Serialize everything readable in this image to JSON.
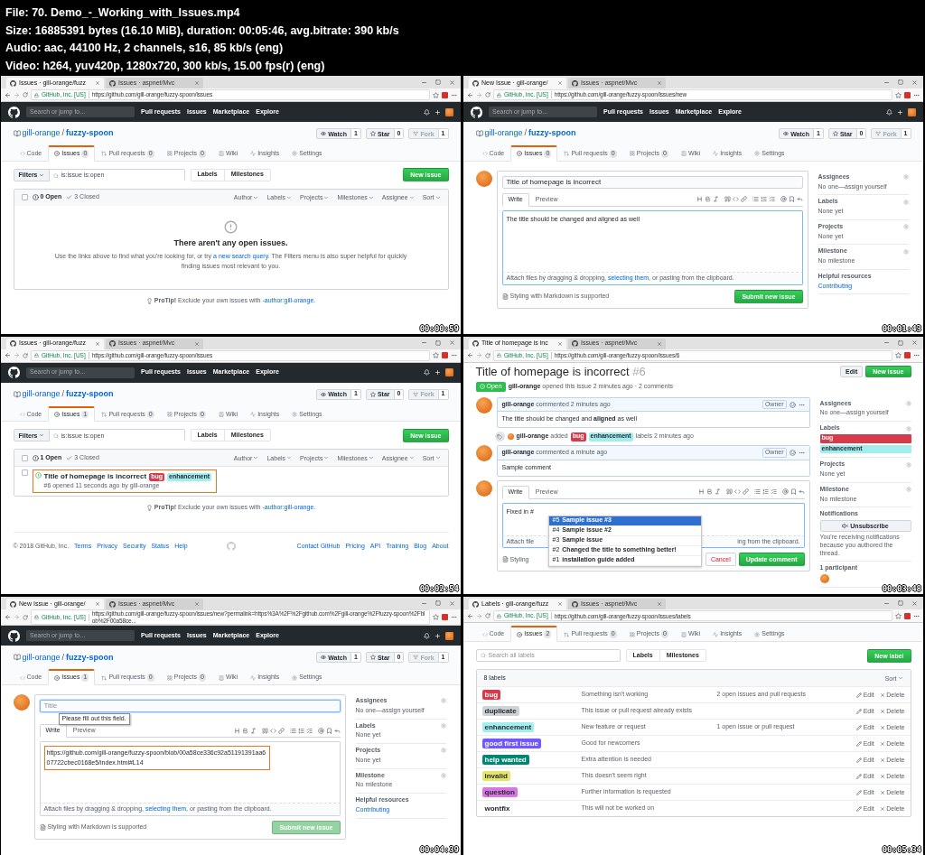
{
  "file_info": [
    "File: 70. Demo_-_Working_with_Issues.mp4",
    "Size: 16885391 bytes (16.10 MiB), duration: 00:05:46, avg.bitrate: 390 kb/s",
    "Audio: aac, 44100 Hz, 2 channels, s16, 85 kb/s (eng)",
    "Video: h264, yuv420p, 1280x720, 300 kb/s, 15.00 fps(r) (eng)"
  ],
  "frames": [
    {
      "timestamp": "00:00:59",
      "browser": {
        "tabs": [
          {
            "title": "Issues · gill-orange/fuzz",
            "selected": true
          },
          {
            "title": "Issues · aspnet/Mvc",
            "selected": false
          }
        ],
        "site": "GitHub, Inc. [US]",
        "url": "https://github.com/gill-orange/fuzzy-spoon/issues"
      },
      "header": {
        "search": {
          "placeholder": "Search or jump to..."
        },
        "links": [
          "Pull requests",
          "Issues",
          "Marketplace",
          "Explore"
        ]
      },
      "repo": {
        "owner": "gill-orange",
        "separator": "/",
        "name": "fuzzy-spoon",
        "actions": [
          {
            "label": "Watch",
            "count": "1",
            "disabled": false
          },
          {
            "label": "Star",
            "count": "0",
            "disabled": false
          },
          {
            "label": "Fork",
            "count": "1",
            "disabled": true
          }
        ],
        "tabs": [
          {
            "label": "Code",
            "selected": false
          },
          {
            "label": "Issues",
            "count": "0",
            "selected": true
          },
          {
            "label": "Pull requests",
            "count": "0",
            "selected": false
          },
          {
            "label": "Projects",
            "count": "0",
            "selected": false
          },
          {
            "label": "Wiki",
            "selected": false
          },
          {
            "label": "Insights",
            "selected": false
          },
          {
            "label": "Settings",
            "selected": false
          }
        ]
      },
      "content": {
        "kind": "issues",
        "filters_button": "Filters",
        "search": {
          "value": "is:issue is:open"
        },
        "nav": [
          "Labels",
          "Milestones"
        ],
        "new_button": "New issue",
        "select_all_checked": false,
        "open_count": "0 Open",
        "closed_count": "3 Closed",
        "sorters": [
          "Author",
          "Labels",
          "Projects",
          "Milestones",
          "Assignee",
          "Sort"
        ],
        "blankslate": {
          "title": "There aren't any open issues.",
          "text_before": "Use the links above to find what you're looking for, or try",
          "link": "a new search query",
          "text_after": ". The Filters menu is also super helpful for quickly finding issues most relevant to you."
        },
        "protip": {
          "label": "ProTip!",
          "text": "Exclude your own issues with",
          "link": "-author:gill-orange."
        }
      }
    },
    {
      "timestamp": "00:01:43",
      "browser": {
        "tabs": [
          {
            "title": "New Issue · gill-orange/",
            "selected": true
          },
          {
            "title": "Issues · aspnet/Mvc",
            "selected": false
          }
        ],
        "site": "GitHub, Inc. [US]",
        "url": "https://github.com/gill-orange/fuzzy-spoon/issues/new"
      },
      "header": {
        "search": {
          "placeholder": "Search or jump to..."
        },
        "links": [
          "Pull requests",
          "Issues",
          "Marketplace",
          "Explore"
        ]
      },
      "repo": {
        "owner": "gill-orange",
        "separator": "/",
        "name": "fuzzy-spoon",
        "actions": [
          {
            "label": "Watch",
            "count": "1",
            "disabled": false
          },
          {
            "label": "Star",
            "count": "0",
            "disabled": false
          },
          {
            "label": "Fork",
            "count": "1",
            "disabled": true
          }
        ],
        "tabs": [
          {
            "label": "Code",
            "selected": false
          },
          {
            "label": "Issues",
            "count": "0",
            "selected": true
          },
          {
            "label": "Pull requests",
            "count": "0",
            "selected": false
          },
          {
            "label": "Projects",
            "count": "0",
            "selected": false
          },
          {
            "label": "Wiki",
            "selected": false
          },
          {
            "label": "Insights",
            "selected": false
          },
          {
            "label": "Settings",
            "selected": false
          }
        ]
      },
      "content": {
        "kind": "new_issue",
        "title_field": {
          "value": "Title of homepage is incorrect",
          "focused": false
        },
        "editor_tabs": [
          {
            "label": "Write",
            "selected": true
          },
          {
            "label": "Preview",
            "selected": false
          }
        ],
        "body": {
          "value": "The title should be changed and aligned as well",
          "highlighted": false
        },
        "attach": {
          "before": "Attach files by dragging & dropping,",
          "link": "selecting them",
          "after": ", or pasting from the clipboard."
        },
        "markdown_note": "Styling with Markdown is supported",
        "submit": {
          "label": "Submit new issue",
          "disabled": false
        },
        "sidebar": [
          {
            "title": "Assignees",
            "value": "No one—assign yourself"
          },
          {
            "title": "Labels",
            "value": "None yet"
          },
          {
            "title": "Projects",
            "value": "None yet"
          },
          {
            "title": "Milestone",
            "value": "No milestone"
          },
          {
            "title": "Helpful resources",
            "link": "Contributing"
          }
        ]
      }
    },
    {
      "timestamp": "00:02:54",
      "browser": {
        "tabs": [
          {
            "title": "Issues · gill-orange/fuzz",
            "selected": true
          },
          {
            "title": "Issues · aspnet/Mvc",
            "selected": false
          }
        ],
        "site": "GitHub, Inc. [US]",
        "url": "https://github.com/gill-orange/fuzzy-spoon/issues"
      },
      "header": {
        "search": {
          "placeholder": "Search or jump to..."
        },
        "links": [
          "Pull requests",
          "Issues",
          "Marketplace",
          "Explore"
        ]
      },
      "repo": {
        "owner": "gill-orange",
        "separator": "/",
        "name": "fuzzy-spoon",
        "actions": [
          {
            "label": "Watch",
            "count": "1",
            "disabled": false
          },
          {
            "label": "Star",
            "count": "0",
            "disabled": false
          },
          {
            "label": "Fork",
            "count": "1",
            "disabled": true
          }
        ],
        "tabs": [
          {
            "label": "Code",
            "selected": false
          },
          {
            "label": "Issues",
            "count": "1",
            "selected": true
          },
          {
            "label": "Pull requests",
            "count": "0",
            "selected": false
          },
          {
            "label": "Projects",
            "count": "0",
            "selected": false
          },
          {
            "label": "Wiki",
            "selected": false
          },
          {
            "label": "Insights",
            "selected": false
          },
          {
            "label": "Settings",
            "selected": false
          }
        ]
      },
      "content": {
        "kind": "issues",
        "filters_button": "Filters",
        "search": {
          "value": "is:issue is:open"
        },
        "nav": [
          "Labels",
          "Milestones"
        ],
        "new_button": "New issue",
        "select_all_checked": false,
        "open_count": "1 Open",
        "closed_count": "3 Closed",
        "sorters": [
          "Author",
          "Labels",
          "Projects",
          "Milestones",
          "Assignee",
          "Sort"
        ],
        "rows": [
          {
            "title": "Title of homepage is incorrect",
            "labels": [
              {
                "name": "bug",
                "color": "#d73a4a"
              },
              {
                "name": "enhancement",
                "color": "#a2eeef"
              }
            ],
            "meta": "#6 opened 11 seconds ago by gill-orange",
            "highlighted": true,
            "checked": false
          }
        ],
        "protip": {
          "label": "ProTip!",
          "text": "Exclude your own issues with",
          "link": "-author:gill-orange."
        },
        "footer": {
          "copyright": "© 2018 GitHub, Inc.",
          "left": [
            "Terms",
            "Privacy",
            "Security",
            "Status",
            "Help"
          ],
          "right": [
            "Contact GitHub",
            "Pricing",
            "API",
            "Training",
            "Blog",
            "About"
          ]
        }
      }
    },
    {
      "timestamp": "00:03:48",
      "browser": {
        "tabs": [
          {
            "title": "Title of homepage is inc",
            "selected": true
          },
          {
            "title": "Issues · aspnet/Mvc",
            "selected": false
          }
        ],
        "site": "GitHub, Inc. [US]",
        "url": "https://github.com/gill-orange/fuzzy-spoon/issues/6"
      },
      "content": {
        "kind": "issue",
        "title": "Title of homepage is incorrect",
        "number": "#6",
        "header_buttons": [
          {
            "label": "Edit",
            "primary": false
          },
          {
            "label": "New issue",
            "primary": true
          }
        ],
        "state": "Open",
        "author": "gill-orange",
        "meta": "opened this issue 2 minutes ago · 2 comments",
        "timeline": [
          {
            "kind": "comment",
            "author": "gill-orange",
            "time": "commented 2 minutes ago",
            "badge": "Owner",
            "body": "The title should be changed and **aligned** as well"
          },
          {
            "kind": "labels",
            "author": "gill-orange",
            "action": "added",
            "labels": [
              {
                "name": "bug",
                "color": "#d73a4a"
              },
              {
                "name": "enhancement",
                "color": "#a2eeef"
              }
            ],
            "time": "labels 2 minutes ago"
          },
          {
            "kind": "comment",
            "author": "gill-orange",
            "time": "commented a minute ago",
            "badge": "Owner",
            "body": "Sample comment"
          }
        ],
        "editor": {
          "tabs": [
            {
              "label": "Write",
              "selected": true
            },
            {
              "label": "Preview",
              "selected": false
            }
          ],
          "value": "Fixed in #",
          "suggestions": [
            {
              "number": "#5",
              "title": "Sample issue #3",
              "selected": true
            },
            {
              "number": "#4",
              "title": "Sample issue #2",
              "selected": false
            },
            {
              "number": "#3",
              "title": "Sample issue",
              "selected": false
            },
            {
              "number": "#2",
              "title": "Changed the title to something better!",
              "selected": false
            },
            {
              "number": "#1",
              "title": "installation guide added",
              "selected": false
            }
          ],
          "attach_left": "Attach file",
          "attach_right": "ing from the clipboard.",
          "markdown_note": "Styling",
          "cancel": "Cancel",
          "submit": "Update comment"
        },
        "sidebar": [
          {
            "title": "Assignees",
            "value": "No one—assign yourself"
          },
          {
            "title": "Labels",
            "labels": [
              {
                "name": "bug",
                "color": "#d73a4a"
              },
              {
                "name": "enhancement",
                "color": "#a2eeef"
              }
            ]
          },
          {
            "title": "Projects",
            "value": "None yet"
          },
          {
            "title": "Milestone",
            "value": "No milestone"
          },
          {
            "title": "Notifications",
            "button": "Unsubscribe",
            "note": "You're receiving notifications because you authored the thread."
          },
          {
            "title": "1 participant",
            "avatar": true
          }
        ]
      }
    },
    {
      "timestamp": "00:04:39",
      "browser": {
        "tabs": [
          {
            "title": "New Issue · gill-orange/",
            "selected": true
          },
          {
            "title": "Issues · aspnet/Mvc",
            "selected": false
          }
        ],
        "site": "GitHub, Inc. [US]",
        "url": "https://github.com/gill-orange/fuzzy-spoon/issues/new?permalink=https%3A%2F%2Fgithub.com%2Fgill-orange%2Ffuzzy-spoon%2Fblob%2F00a58ce..."
      },
      "header": {
        "search": {
          "placeholder": "Search or jump to..."
        },
        "links": [
          "Pull requests",
          "Issues",
          "Marketplace",
          "Explore"
        ]
      },
      "repo": {
        "owner": "gill-orange",
        "separator": "/",
        "name": "fuzzy-spoon",
        "actions": [
          {
            "label": "Watch",
            "count": "1",
            "disabled": false
          },
          {
            "label": "Star",
            "count": "0",
            "disabled": false
          },
          {
            "label": "Fork",
            "count": "1",
            "disabled": true
          }
        ],
        "tabs": [
          {
            "label": "Code",
            "selected": false
          },
          {
            "label": "Issues",
            "count": "1",
            "selected": true
          },
          {
            "label": "Pull requests",
            "count": "0",
            "selected": false
          },
          {
            "label": "Projects",
            "count": "0",
            "selected": false
          },
          {
            "label": "Wiki",
            "selected": false
          },
          {
            "label": "Insights",
            "selected": false
          },
          {
            "label": "Settings",
            "selected": false
          }
        ]
      },
      "content": {
        "kind": "new_issue",
        "title_field": {
          "placeholder": "Title",
          "focused": true,
          "tooltip": "Please fill out this field."
        },
        "editor_tabs": [
          {
            "label": "Write",
            "selected": true
          },
          {
            "label": "Preview",
            "selected": false
          }
        ],
        "body": {
          "value": "https://github.com/gill-orange/fuzzy-spoon/blob/00a58ce336c92a51191391aa607722cbec0168e5/index.html#L14",
          "highlighted": true
        },
        "attach": {
          "before": "Attach files by dragging & dropping,",
          "link": "selecting them",
          "after": ", or pasting from the clipboard."
        },
        "markdown_note": "Styling with Markdown is supported",
        "submit": {
          "label": "Submit new issue",
          "disabled": true
        },
        "sidebar": [
          {
            "title": "Assignees",
            "value": "No one—assign yourself"
          },
          {
            "title": "Labels",
            "value": "None yet"
          },
          {
            "title": "Projects",
            "value": "None yet"
          },
          {
            "title": "Milestone",
            "value": "No milestone"
          },
          {
            "title": "Helpful resources",
            "link": "Contributing"
          }
        ]
      }
    },
    {
      "timestamp": "00:05:34",
      "browser": {
        "tabs": [
          {
            "title": "Labels · gill-orange/fuzz",
            "selected": true
          },
          {
            "title": "Issues · aspnet/Mvc",
            "selected": false
          }
        ],
        "site": "GitHub, Inc. [US]",
        "url": "https://github.com/gill-orange/fuzzy-spoon/issues/labels"
      },
      "repo": {
        "tabs": [
          {
            "label": "Code",
            "selected": false
          },
          {
            "label": "Issues",
            "count": "2",
            "selected": true
          },
          {
            "label": "Pull requests",
            "count": "0",
            "selected": false
          },
          {
            "label": "Projects",
            "count": "0",
            "selected": false
          },
          {
            "label": "Wiki",
            "selected": false
          },
          {
            "label": "Insights",
            "selected": false
          },
          {
            "label": "Settings",
            "selected": false
          }
        ]
      },
      "content": {
        "kind": "labels",
        "search": {
          "placeholder": "Search all labels"
        },
        "nav": [
          "Labels",
          "Milestones"
        ],
        "new_button": "New label",
        "count": "8 labels",
        "sort": "Sort",
        "rows": [
          {
            "name": "bug",
            "color": "#d73a4a",
            "description": "Something isn't working",
            "usage": "2 open issues and pull requests",
            "actions": [
              "Edit",
              "Delete"
            ]
          },
          {
            "name": "duplicate",
            "color": "#cfd3d7",
            "description": "This issue or pull request already exists",
            "actions": [
              "Edit",
              "Delete"
            ]
          },
          {
            "name": "enhancement",
            "color": "#a2eeef",
            "description": "New feature or request",
            "usage": "1 open issue or pull request",
            "actions": [
              "Edit",
              "Delete"
            ]
          },
          {
            "name": "good first issue",
            "color": "#7057ff",
            "description": "Good for newcomers",
            "actions": [
              "Edit",
              "Delete"
            ]
          },
          {
            "name": "help wanted",
            "color": "#008672",
            "description": "Extra attention is needed",
            "actions": [
              "Edit",
              "Delete"
            ]
          },
          {
            "name": "invalid",
            "color": "#e4e669",
            "description": "This doesn't seem right",
            "actions": [
              "Edit",
              "Delete"
            ]
          },
          {
            "name": "question",
            "color": "#d876e3",
            "description": "Further information is requested",
            "actions": [
              "Edit",
              "Delete"
            ]
          },
          {
            "name": "wontfix",
            "color": "#ffffff",
            "description": "This will not be worked on",
            "actions": [
              "Edit",
              "Delete"
            ]
          }
        ]
      }
    }
  ]
}
